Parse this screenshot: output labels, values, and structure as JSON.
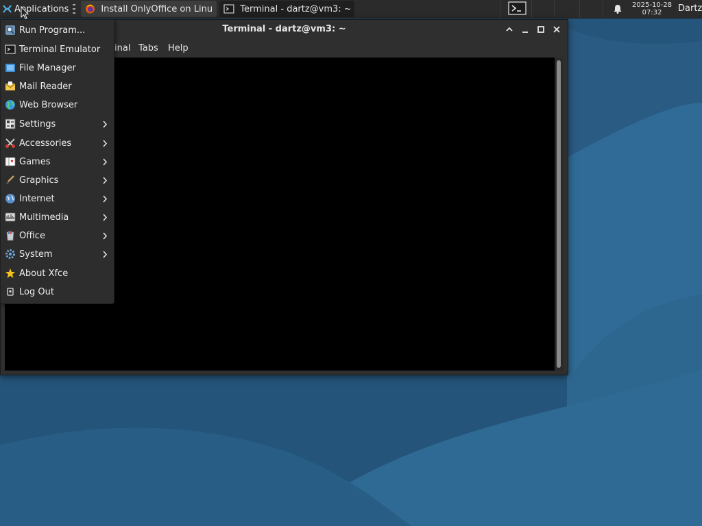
{
  "panel": {
    "applications_label": "Applications",
    "tasks": [
      {
        "title": "Install OnlyOffice on Linu...",
        "icon": "firefox-icon"
      },
      {
        "title": "Terminal - dartz@vm3: ~",
        "icon": "terminal-icon"
      }
    ],
    "clock": {
      "date": "2025-10-28",
      "time": "07:32"
    },
    "user": "Dartz"
  },
  "window": {
    "title": "Terminal - dartz@vm3: ~",
    "menu": {
      "terminal": "inal",
      "tabs": "Tabs",
      "help": "Help"
    }
  },
  "app_menu": {
    "items": [
      {
        "label": "Run Program...",
        "icon": "search-icon",
        "submenu": false
      },
      {
        "label": "Terminal Emulator",
        "icon": "terminal-icon",
        "submenu": false
      },
      {
        "label": "File Manager",
        "icon": "file-manager-icon",
        "submenu": false
      },
      {
        "label": "Mail Reader",
        "icon": "mail-icon",
        "submenu": false
      },
      {
        "label": "Web Browser",
        "icon": "globe-icon",
        "submenu": false
      },
      {
        "label": "Settings",
        "icon": "settings-icon",
        "submenu": true
      },
      {
        "label": "Accessories",
        "icon": "accessories-icon",
        "submenu": true
      },
      {
        "label": "Games",
        "icon": "games-icon",
        "submenu": true
      },
      {
        "label": "Graphics",
        "icon": "graphics-icon",
        "submenu": true
      },
      {
        "label": "Internet",
        "icon": "internet-icon",
        "submenu": true
      },
      {
        "label": "Multimedia",
        "icon": "multimedia-icon",
        "submenu": true
      },
      {
        "label": "Office",
        "icon": "office-icon",
        "submenu": true
      },
      {
        "label": "System",
        "icon": "system-icon",
        "submenu": true
      },
      {
        "label": "About Xfce",
        "icon": "star-icon",
        "submenu": false
      },
      {
        "label": "Log Out",
        "icon": "logout-icon",
        "submenu": false
      }
    ]
  },
  "colors": {
    "panel_bg": "#2b2b2b",
    "menu_bg": "#2d2d2d",
    "wallpaper_dark": "#1f4c70",
    "wallpaper_light": "#2f6e98",
    "terminal_bg": "#000000"
  }
}
